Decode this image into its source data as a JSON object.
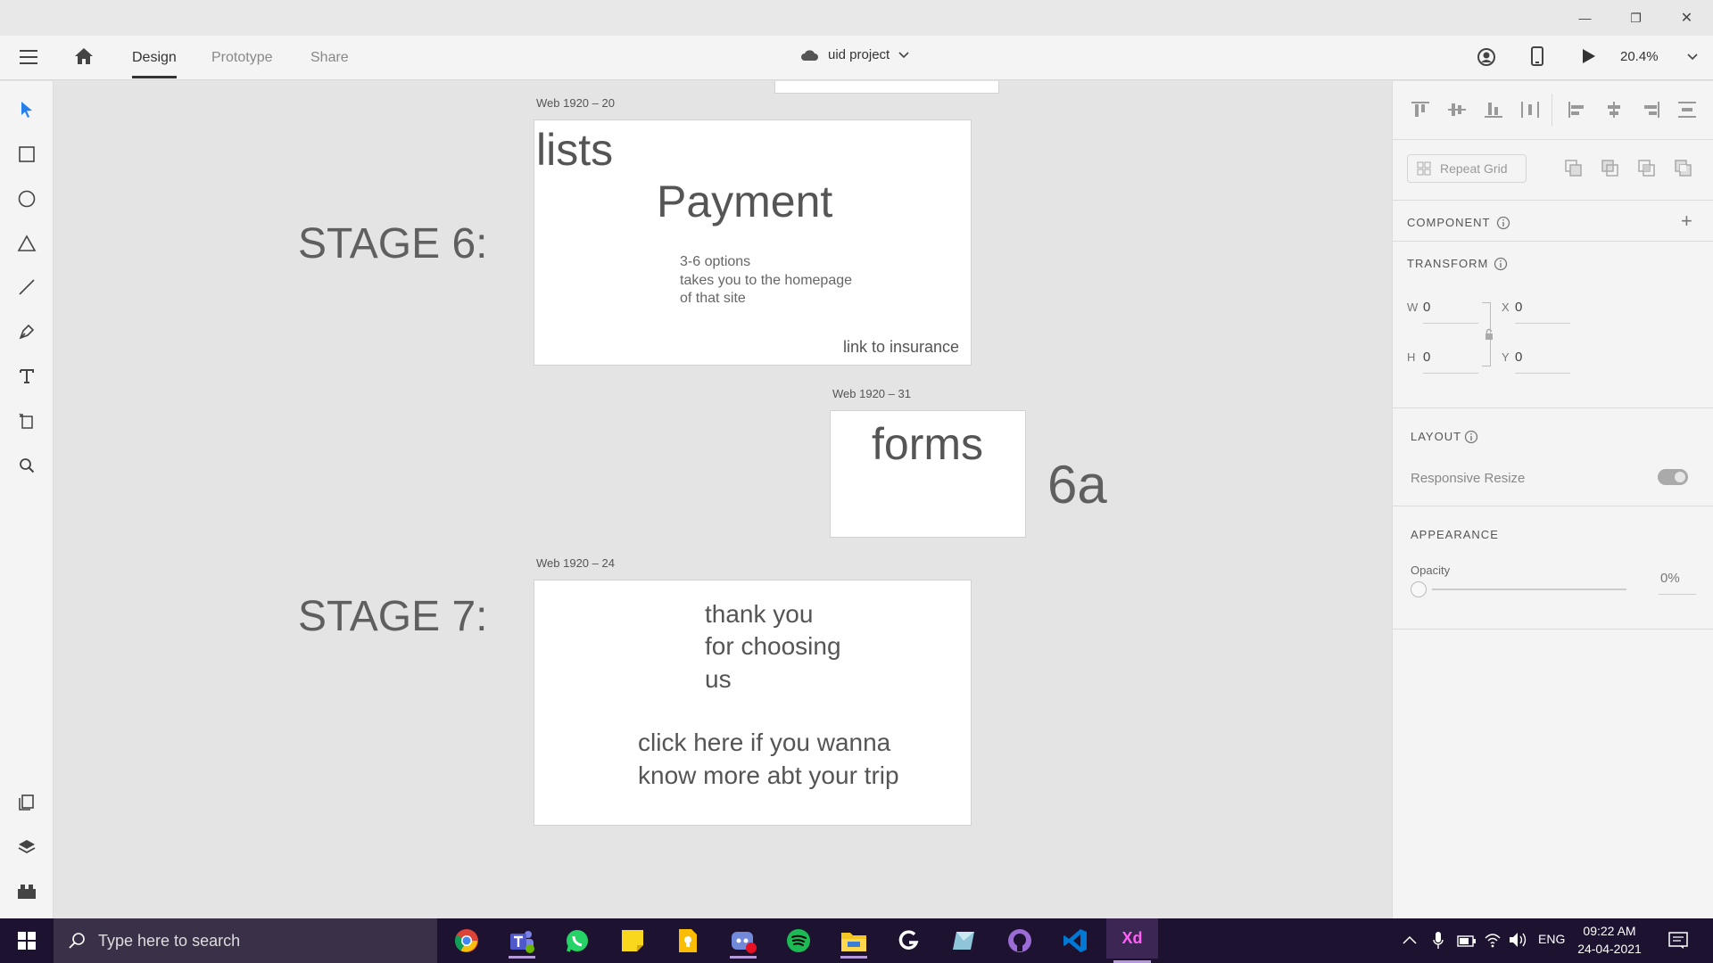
{
  "window": {
    "minimize": "—",
    "maximize": "❐",
    "close": "✕"
  },
  "menu": {
    "tabs": [
      "Design",
      "Prototype",
      "Share"
    ],
    "active_tab": "Design",
    "project_name": "uid project",
    "zoom": "20.4%"
  },
  "tools": [
    "select-icon",
    "rectangle-icon",
    "ellipse-icon",
    "triangle-icon",
    "line-icon",
    "pen-icon",
    "text-icon",
    "artboard-icon",
    "zoom-icon",
    "plugins-icon",
    "layers-icon",
    "assets-icon"
  ],
  "canvas": {
    "stages": [
      "STAGE 6:",
      "STAGE 7:"
    ],
    "artboards": [
      {
        "label": "Web 1920 – 20",
        "texts": [
          "lists",
          "Payment",
          "3-6 options",
          "takes you to the homepage",
          "of that site",
          "link to insurance"
        ]
      },
      {
        "label": "Web 1920 – 31",
        "texts": [
          "forms"
        ]
      },
      {
        "label": "Web 1920 – 24",
        "texts": [
          "thank you",
          "for choosing",
          "us",
          "click here if you wanna",
          "know more abt your trip"
        ]
      }
    ],
    "note_6a": "6a"
  },
  "panel": {
    "repeat_grid": "Repeat Grid",
    "component_title": "COMPONENT",
    "transform_title": "TRANSFORM",
    "w_label": "W",
    "w_value": "0",
    "h_label": "H",
    "h_value": "0",
    "x_label": "X",
    "x_value": "0",
    "y_label": "Y",
    "y_value": "0",
    "layout_title": "LAYOUT",
    "responsive_resize": "Responsive Resize",
    "appearance_title": "APPEARANCE",
    "opacity_label": "Opacity",
    "opacity_value": "0%"
  },
  "taskbar": {
    "search_placeholder": "Type here to search",
    "apps": [
      "chrome-icon",
      "teams-icon",
      "whatsapp-icon",
      "sticky-notes-icon",
      "keep-icon",
      "discord-icon",
      "spotify-icon",
      "file-explorer-icon",
      "logitech-icon",
      "photos-icon",
      "github-icon",
      "vscode-icon",
      "xd-icon"
    ],
    "tray_lang": "ENG",
    "time": "09:22 AM",
    "date": "24-04-2021"
  },
  "colors": {
    "xd_brand": "#470137",
    "xd_text": "#ff61f6",
    "taskbar": "#1d1331",
    "accent": "#2680eb"
  }
}
